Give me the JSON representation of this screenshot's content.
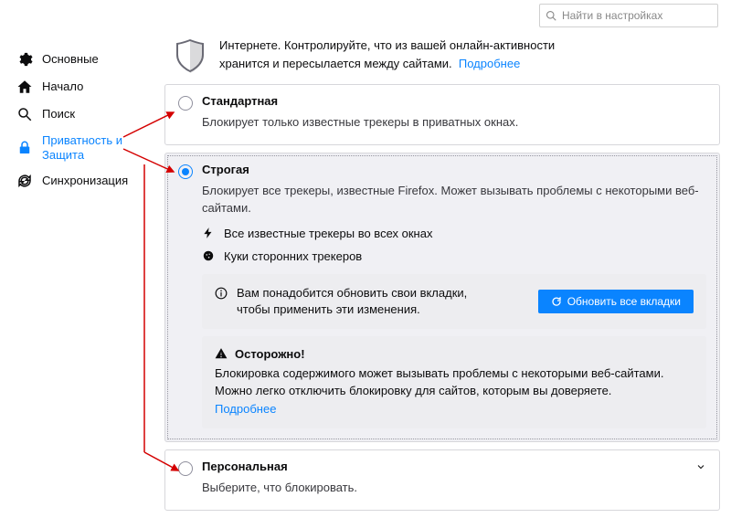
{
  "search": {
    "placeholder": "Найти в настройках"
  },
  "sidebar": {
    "items": [
      {
        "label": "Основные"
      },
      {
        "label": "Начало"
      },
      {
        "label": "Поиск"
      },
      {
        "label": "Приватность и Защита"
      },
      {
        "label": "Синхронизация"
      }
    ]
  },
  "intro": {
    "text1": "Интернете. Контролируйте, что из вашей онлайн-активности",
    "text2": "хранится и пересылается между сайтами.",
    "more": "Подробнее"
  },
  "standard": {
    "title": "Стандартная",
    "desc": "Блокирует только известные трекеры в приватных окнах."
  },
  "strict": {
    "title": "Строгая",
    "desc": "Блокирует все трекеры, известные Firefox. Может вызывать проблемы с некоторыми веб-сайтами.",
    "feature1": "Все известные трекеры во всех окнах",
    "feature2": "Куки сторонних трекеров",
    "notice_text": "Вам понадобится обновить свои вкладки, чтобы применить эти изменения.",
    "reload_btn": "Обновить все вкладки",
    "warn_title": "Осторожно!",
    "warn_body": "Блокировка содержимого может вызывать проблемы с некоторыми веб-сайтами. Можно легко отключить блокировку для сайтов, которым вы доверяете.",
    "warn_more": "Подробнее"
  },
  "custom": {
    "title": "Персональная",
    "desc": "Выберите, что блокировать."
  }
}
